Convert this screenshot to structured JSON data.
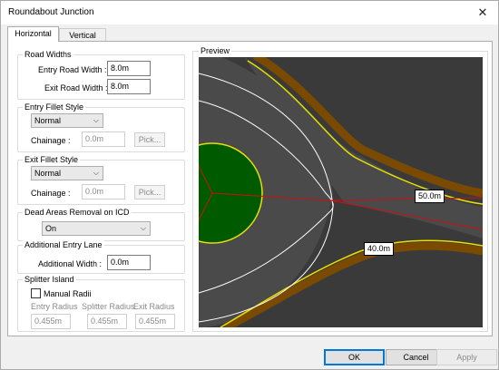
{
  "window": {
    "title": "Roundabout Junction",
    "close_glyph": "✕"
  },
  "tabs": [
    {
      "label": "Horizontal",
      "active": true
    },
    {
      "label": "Vertical",
      "active": false
    }
  ],
  "road_widths": {
    "title": "Road Widths",
    "entry_label": "Entry Road Width :",
    "entry_value": "8.0m",
    "exit_label": "Exit Road Width :",
    "exit_value": "8.0m"
  },
  "entry_fillet": {
    "title": "Entry Fillet Style",
    "style_value": "Normal",
    "chainage_label": "Chainage :",
    "chainage_value": "0.0m",
    "pick_label": "Pick..."
  },
  "exit_fillet": {
    "title": "Exit Fillet Style",
    "style_value": "Normal",
    "chainage_label": "Chainage :",
    "chainage_value": "0.0m",
    "pick_label": "Pick..."
  },
  "dead_areas": {
    "title": "Dead Areas Removal on ICD",
    "value": "On"
  },
  "additional_lane": {
    "title": "Additional Entry Lane",
    "width_label": "Additional Width :",
    "width_value": "0.0m"
  },
  "splitter": {
    "title": "Splitter Island",
    "manual_radii_label": "Manual Radii",
    "manual_radii_checked": false,
    "entry_radius_label": "Entry Radius",
    "entry_radius_value": "0.455m",
    "splitter_radius_label": "Splitter Radius",
    "splitter_radius_value": "0.455m",
    "exit_radius_label": "Exit Radius",
    "exit_radius_value": "0.455m"
  },
  "preview": {
    "title": "Preview",
    "label_upper": "50.0m",
    "label_lower": "40.0m",
    "colors": {
      "background": "#3a3a3a",
      "road": "#4a4a4a",
      "island": "#005a00",
      "kerb": "#e8e000",
      "verge": "#7a4a00",
      "centerline": "#cc1111"
    }
  },
  "buttons": {
    "ok": "OK",
    "cancel": "Cancel",
    "apply": "Apply"
  }
}
